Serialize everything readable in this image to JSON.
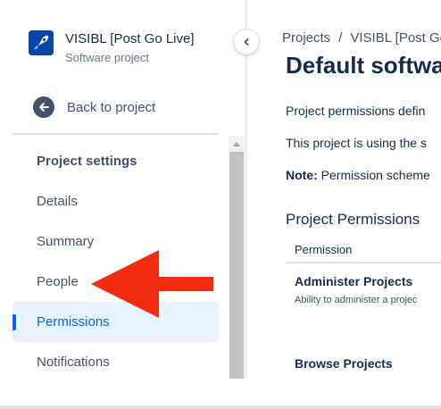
{
  "project": {
    "name": "VISIBL [Post Go Live]",
    "type": "Software project",
    "avatar_icon": "rocket-icon"
  },
  "sidebar": {
    "back_label": "Back to project",
    "heading": "Project settings",
    "items": [
      {
        "label": "Details",
        "active": false
      },
      {
        "label": "Summary",
        "active": false
      },
      {
        "label": "People",
        "active": false
      },
      {
        "label": "Permissions",
        "active": true
      },
      {
        "label": "Notifications",
        "active": false
      }
    ]
  },
  "main": {
    "breadcrumb": {
      "projects": "Projects",
      "separator": "/",
      "project": "VISIBL [Post Go"
    },
    "title": "Default softwa",
    "para1": "Project permissions defin",
    "para2": "This project is using the s",
    "note_label": "Note:",
    "note_text": "Permission scheme",
    "section_title": "Project Permissions",
    "table_header": "Permission",
    "permissions": [
      {
        "name": "Administer Projects",
        "description": "Ability to administer a projec"
      },
      {
        "name": "Browse Projects",
        "description": ""
      }
    ]
  },
  "colors": {
    "accent": "#0c66e4",
    "active_bg": "#e9f2ff",
    "annotation_arrow": "#f42c10"
  }
}
